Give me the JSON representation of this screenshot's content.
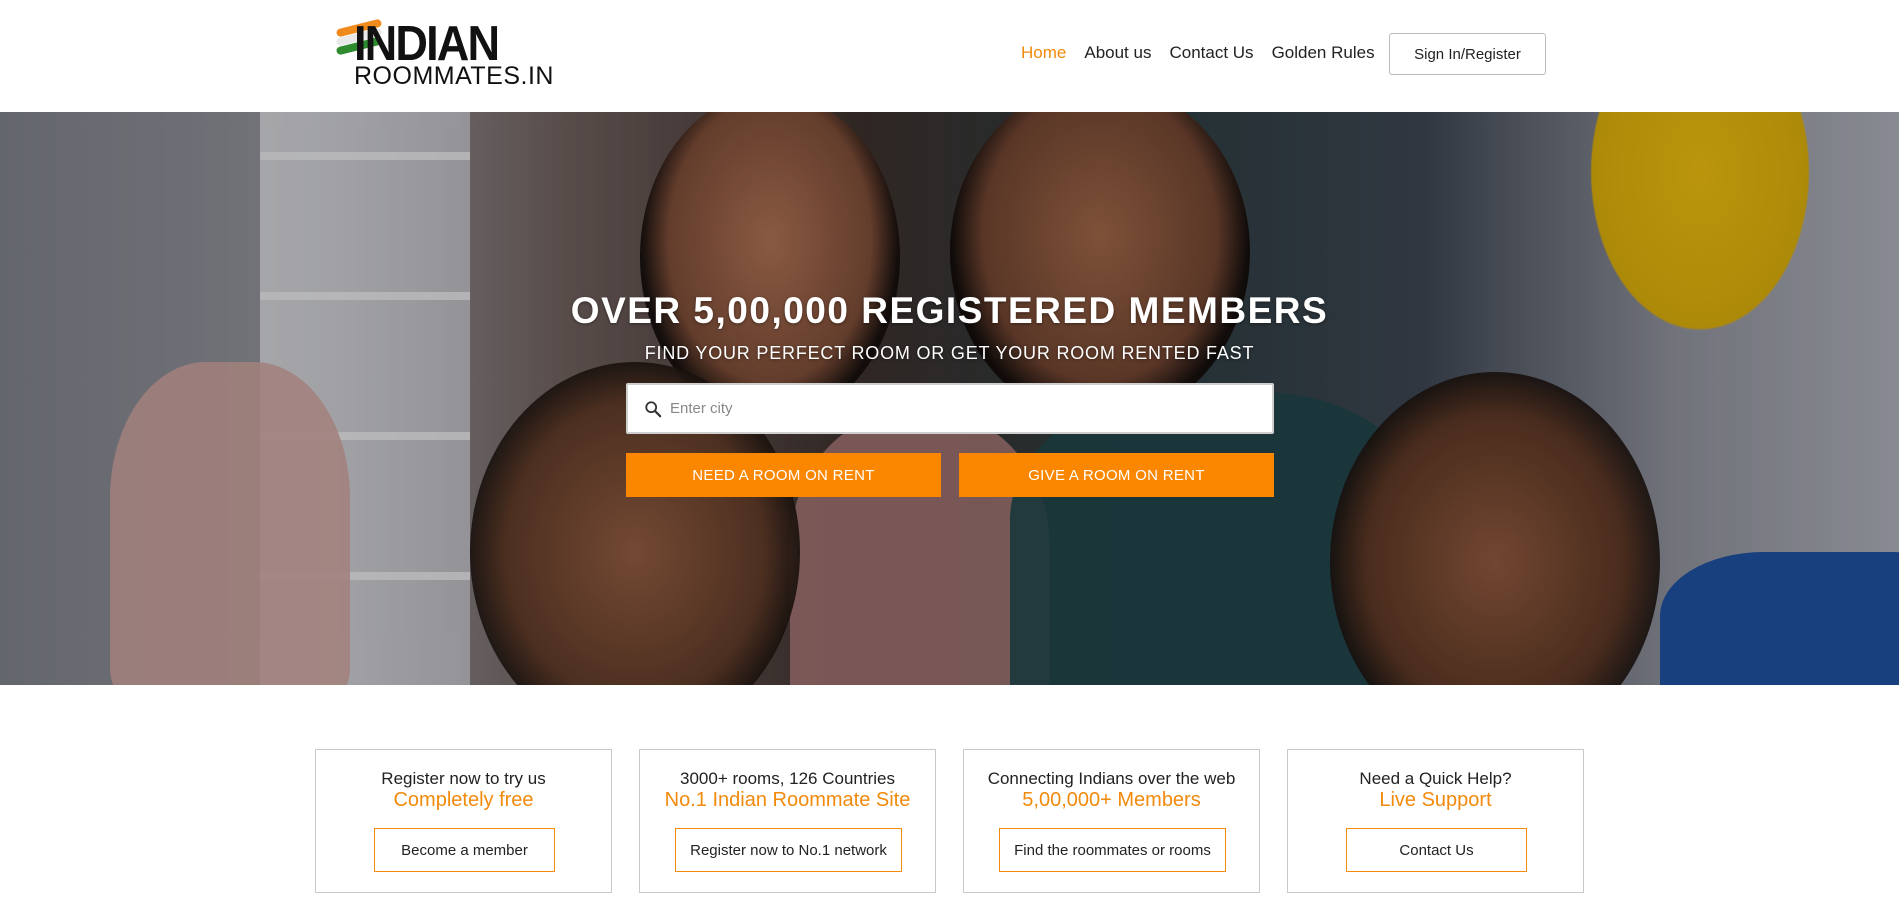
{
  "brand": {
    "logo_main": "INDIAN",
    "logo_sub": "ROOMMATES.IN",
    "colors": {
      "accent": "#fb8600",
      "accent_text": "#f28a0c",
      "text": "#222222"
    }
  },
  "nav": {
    "items": [
      {
        "label": "Home",
        "active": true
      },
      {
        "label": "About us",
        "active": false
      },
      {
        "label": "Contact Us",
        "active": false
      },
      {
        "label": "Golden Rules",
        "active": false
      }
    ],
    "signin_label": "Sign In/Register"
  },
  "hero": {
    "title": "OVER 5,00,000 REGISTERED MEMBERS",
    "subtitle": "FIND YOUR PERFECT ROOM OR GET YOUR ROOM RENTED FAST",
    "search": {
      "placeholder": "Enter city",
      "value": "",
      "icon": "search-icon"
    },
    "need_button": "NEED A ROOM ON RENT",
    "give_button": "GIVE A ROOM ON RENT"
  },
  "features": [
    {
      "line1": "Register now to try us",
      "line2": "Completely free",
      "cta": "Become a member"
    },
    {
      "line1": "3000+ rooms, 126 Countries",
      "line2": "No.1 Indian Roommate Site",
      "cta": "Register now to No.1 network"
    },
    {
      "line1": "Connecting Indians over the web",
      "line2": "5,00,000+ Members",
      "cta": "Find the roommates or rooms"
    },
    {
      "line1": "Need a Quick Help?",
      "line2": "Live Support",
      "cta": "Contact Us"
    }
  ]
}
